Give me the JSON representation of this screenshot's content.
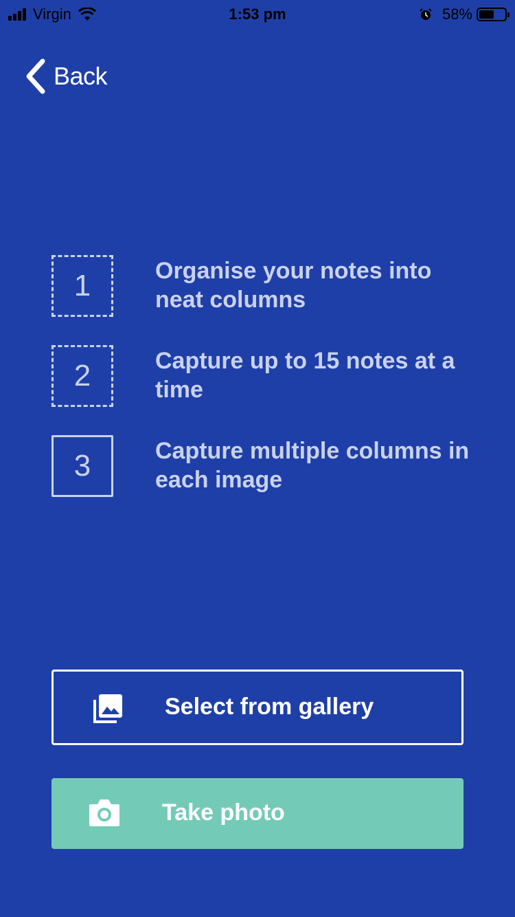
{
  "status_bar": {
    "carrier": "Virgin",
    "time": "1:53 pm",
    "battery_percent": "58%",
    "battery_level": 0.58,
    "icons": [
      "signal-icon",
      "wifi-icon",
      "alarm-icon",
      "battery-icon"
    ]
  },
  "nav": {
    "back_label": "Back",
    "back_icon": "chevron-left-icon"
  },
  "steps": [
    {
      "number": "1",
      "text": "Organise your notes into neat columns",
      "style": "dashed"
    },
    {
      "number": "2",
      "text": "Capture up to 15 notes at a time",
      "style": "dashed"
    },
    {
      "number": "3",
      "text": "Capture multiple columns in each image",
      "style": "solid"
    }
  ],
  "actions": {
    "gallery_label": "Select from gallery",
    "gallery_icon": "gallery-icon",
    "photo_label": "Take photo",
    "photo_icon": "camera-icon"
  },
  "colors": {
    "background": "#1f3fa8",
    "accent": "#73cbb7",
    "step_text": "#c9d2ec"
  }
}
